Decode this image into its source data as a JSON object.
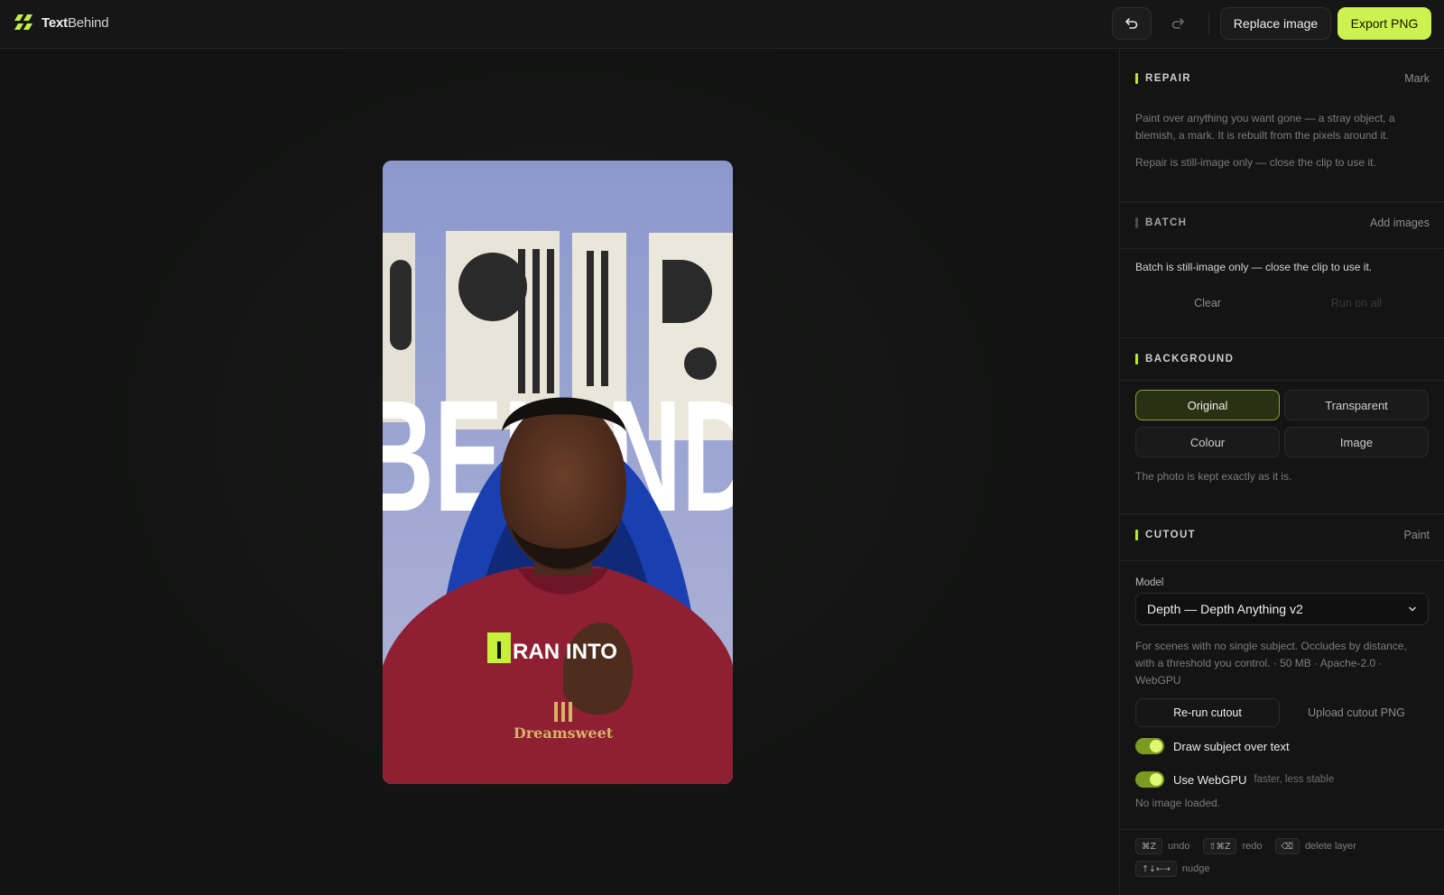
{
  "app": {
    "brand_bold": "Text",
    "brand_light": "Behind"
  },
  "toolbar": {
    "undo_icon": "undo-icon",
    "redo_icon": "redo-icon",
    "replace_label": "Replace image",
    "export_label": "Export PNG"
  },
  "canvas": {
    "headline_text": "BEHIND",
    "caption_highlight": "I",
    "caption_rest": "RAN INTO",
    "shirt_text": "Dreamsweet"
  },
  "repair": {
    "title": "REPAIR",
    "action": "Mark",
    "desc": "Paint over anything you want gone — a stray object, a blemish, a mark. It is rebuilt from the pixels around it.",
    "note": "Repair is still-image only — close the clip to use it."
  },
  "batch": {
    "title": "BATCH",
    "action": "Add images",
    "note": "Batch is still-image only — close the clip to use it.",
    "clear_label": "Clear",
    "run_label": "Run on all"
  },
  "background": {
    "title": "BACKGROUND",
    "options": [
      "Original",
      "Transparent",
      "Colour",
      "Image"
    ],
    "selected": "Original",
    "hint": "The photo is kept exactly as it is."
  },
  "cutout": {
    "title": "CUTOUT",
    "action": "Paint",
    "model_label": "Model",
    "model_value": "Depth — Depth Anything v2",
    "model_desc": "For scenes with no single subject. Occludes by distance, with a threshold you control. · 50 MB · Apache-2.0 · WebGPU",
    "rerun_label": "Re-run cutout",
    "upload_label": "Upload cutout PNG",
    "toggle1_label": "Draw subject over text",
    "toggle1_on": true,
    "toggle2_label": "Use WebGPU",
    "toggle2_hint": "faster, less stable",
    "toggle2_on": true,
    "status": "No image loaded."
  },
  "shortcuts": [
    {
      "keys": "⌘Z",
      "label": "undo"
    },
    {
      "keys": "⇧⌘Z",
      "label": "redo"
    },
    {
      "keys": "⌫",
      "label": "delete layer"
    },
    {
      "keys": "↑↓←→",
      "label": "nudge"
    }
  ],
  "colors": {
    "accent": "#cdf250",
    "panel_bg": "#131413",
    "canvas_bg": "#111211"
  }
}
